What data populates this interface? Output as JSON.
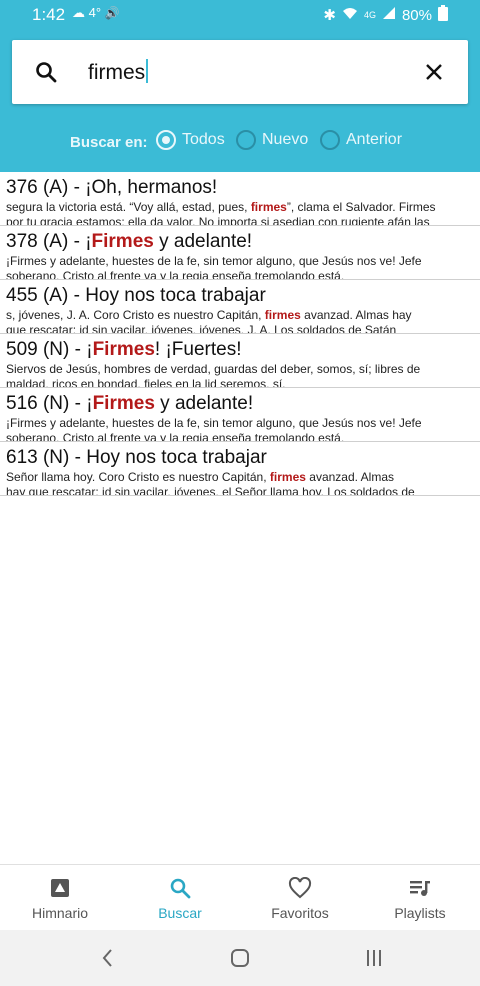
{
  "status": {
    "time": "1:42",
    "weather": "4°",
    "network": "4G",
    "battery": "80%"
  },
  "search": {
    "query": "firmes"
  },
  "filter": {
    "label": "Buscar en:",
    "options": [
      {
        "label": "Todos",
        "selected": true
      },
      {
        "label": "Nuevo",
        "selected": false
      },
      {
        "label": "Anterior",
        "selected": false
      }
    ]
  },
  "results": [
    {
      "title": [
        "376 (A) - ¡Oh, hermanos!",
        "",
        ""
      ],
      "line1": [
        " segura la victoria está. “Voy allá, estad, pues, ",
        "firmes",
        "”, clama el Salvador. Firmes"
      ],
      "line2": "por tu gracia estamos; ella da valor. No importa si asedian con rugiente afán las"
    },
    {
      "title": [
        "378 (A) - ¡",
        "Firmes",
        " y adelante!"
      ],
      "line1": [
        "¡Firmes y adelante, huestes de la fe, sin temor alguno, que Jesús nos ve! Jefe",
        "",
        ""
      ],
      "line2": "soberano, Cristo al frente va y la regia enseña tremolando está."
    },
    {
      "title": [
        "455 (A) - Hoy nos toca trabajar",
        "",
        ""
      ],
      "line1": [
        "s, jóvenes, J. A. Coro Cristo es nuestro Capitán, ",
        "firmes",
        " avanzad. Almas hay"
      ],
      "line2": "que rescatar; id sin vacilar, jóvenes, jóvenes, J. A. Los soldados de Satán"
    },
    {
      "title": [
        "509 (N) - ¡",
        "Firmes",
        "! ¡Fuertes!"
      ],
      "line1": [
        "Siervos de Jesús, hombres de verdad, guardas del deber, somos, sí; libres de",
        "",
        ""
      ],
      "line2": "maldad, ricos en bondad, fieles en la lid seremos, sí."
    },
    {
      "title": [
        "516 (N) - ¡",
        "Firmes",
        " y adelante!"
      ],
      "line1": [
        "¡Firmes y adelante, huestes de la fe, sin temor alguno, que Jesús nos ve! Jefe",
        "",
        ""
      ],
      "line2": "soberano, Cristo al frente va y la regia enseña tremolando está."
    },
    {
      "title": [
        "613 (N) - Hoy nos toca trabajar",
        "",
        ""
      ],
      "line1": [
        " Señor llama hoy. Coro Cristo es nuestro Capitán, ",
        "firmes",
        " avanzad. Almas"
      ],
      "line2": "hay que rescatar; id sin vacilar, jóvenes, el Señor llama hoy. Los soldados de"
    }
  ],
  "nav": [
    {
      "label": "Himnario",
      "icon": "book-icon",
      "active": false
    },
    {
      "label": "Buscar",
      "icon": "search-icon",
      "active": true
    },
    {
      "label": "Favoritos",
      "icon": "heart-icon",
      "active": false
    },
    {
      "label": "Playlists",
      "icon": "playlist-icon",
      "active": false
    }
  ],
  "colors": {
    "accent": "#3bbbd6",
    "highlight": "#b31919",
    "active_nav": "#2aa7c4"
  }
}
